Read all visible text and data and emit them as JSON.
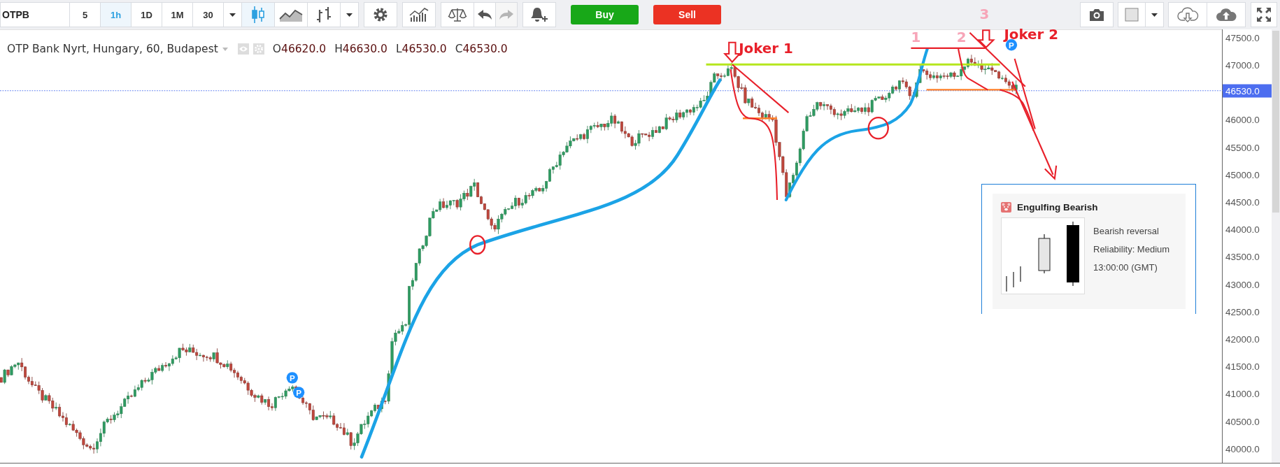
{
  "toolbar": {
    "symbol": "OTPB",
    "intervals": [
      {
        "label": "5",
        "selected": false
      },
      {
        "label": "1h",
        "selected": true
      },
      {
        "label": "1D",
        "selected": false
      },
      {
        "label": "1M",
        "selected": false
      },
      {
        "label": "30",
        "selected": false
      }
    ],
    "chart_types": [
      {
        "kind": "candles",
        "selected": true
      },
      {
        "kind": "line",
        "selected": false
      },
      {
        "kind": "bars",
        "selected": false
      }
    ],
    "history": [
      {
        "kind": "undo",
        "disabled": false
      },
      {
        "kind": "redo",
        "disabled": true
      }
    ],
    "trade_buttons": [
      {
        "kind": "buy",
        "label": "Buy"
      },
      {
        "kind": "sell",
        "label": "Sell"
      }
    ]
  },
  "legend": {
    "title": "OTP Bank Nyrt, Hungary, 60, Budapest",
    "ohlc": [
      {
        "key": "O",
        "value": "46620.0"
      },
      {
        "key": "H",
        "value": "46630.0"
      },
      {
        "key": "L",
        "value": "46530.0"
      },
      {
        "key": "C",
        "value": "46530.0"
      }
    ]
  },
  "annotations": [
    {
      "text": "Joker 1",
      "color": "#e8202a"
    },
    {
      "text": "1",
      "color": "#f7a5b8"
    },
    {
      "text": "2",
      "color": "#f7a5b8"
    },
    {
      "text": "3",
      "color": "#f7a5b8"
    },
    {
      "text": "Joker 2",
      "color": "#e8202a"
    }
  ],
  "pattern_markers": [
    {
      "label": "P"
    },
    {
      "label": "P"
    },
    {
      "label": "P"
    }
  ],
  "pattern_popup": {
    "title": "Engulfing Bearish",
    "lines": [
      "Bearish reversal",
      "Reliability: Medium",
      "13:00:00 (GMT)"
    ]
  },
  "price_axis": {
    "ticks": [
      "47500.0",
      "47000.0",
      "46000.0",
      "45500.0",
      "45000.0",
      "44500.0",
      "44000.0",
      "43500.0",
      "43000.0",
      "42500.0",
      "42000.0",
      "41500.0",
      "41000.0",
      "40500.0",
      "40000.0"
    ],
    "current": "46530.0"
  }
}
